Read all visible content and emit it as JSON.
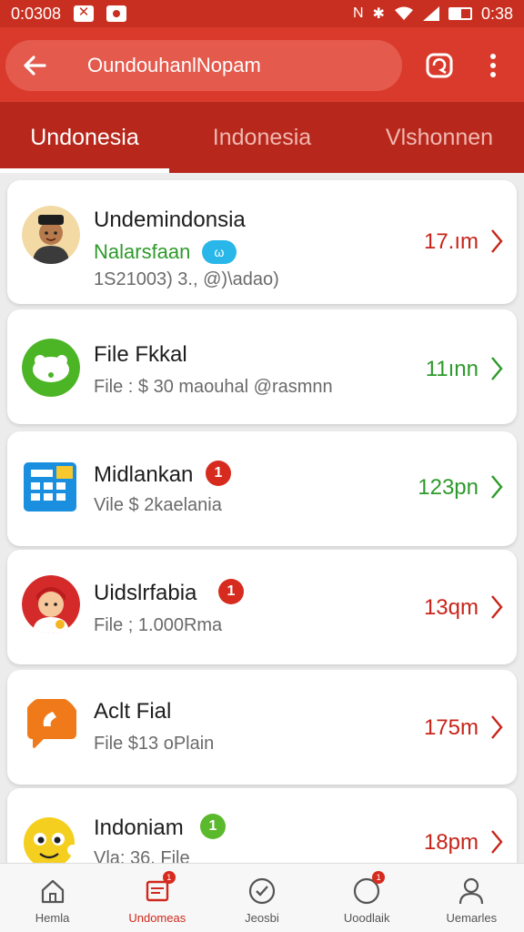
{
  "status_bar": {
    "clock_left": "0:0308",
    "time": "0:38"
  },
  "header": {
    "title": "OundouhanlNopam"
  },
  "tabs": [
    {
      "label": "Undonesia",
      "active": true
    },
    {
      "label": "Indonesia",
      "active": false
    },
    {
      "label": "Vlshonnen",
      "active": false
    }
  ],
  "chats": [
    {
      "name": "Undemindonsia",
      "tag": "Nalarsfaan",
      "tag_pill": "ω",
      "sub": "1S21003) 3., @)\\adao)",
      "time": "17.ım",
      "time_color": "red",
      "avatar": "person-avatar"
    },
    {
      "name": "File Fkkal",
      "sub": "File : $ 30 maouhal @rasmnn",
      "time": "11ınn",
      "time_color": "green",
      "avatar": "green-cloud-avatar"
    },
    {
      "name": "Midlankan",
      "badge": "1",
      "sub": "Vile $ 2kaelania",
      "time": "123pn",
      "time_color": "green",
      "avatar": "grid-app-avatar"
    },
    {
      "name": "Uidslrfabia",
      "badge": "1",
      "sub": "File ; 1.000Rma",
      "time": "13qm",
      "time_color": "red",
      "avatar": "girl-avatar"
    },
    {
      "name": "Aclt Fial",
      "sub": "File $13 oPlain",
      "time": "175m",
      "time_color": "red",
      "avatar": "orange-chat-avatar"
    },
    {
      "name": "Indoniam",
      "badge": "1",
      "sub": "Vla: 36. File",
      "time": "18pm",
      "time_color": "red",
      "avatar": "emoji-avatar"
    }
  ],
  "bottom_nav": [
    {
      "label": "Hemla",
      "icon": "home-icon"
    },
    {
      "label": "Undomeas",
      "icon": "messages-icon",
      "active": true
    },
    {
      "label": "Jeosbi",
      "icon": "status-icon"
    },
    {
      "label": "Uoodlaik",
      "icon": "notification-icon"
    },
    {
      "label": "Uemarles",
      "icon": "profile-icon"
    }
  ],
  "colors": {
    "brand_red": "#d93a2b",
    "tab_bar": "#b7271b",
    "time_red": "#c8241a",
    "time_green": "#2e9a2b"
  }
}
